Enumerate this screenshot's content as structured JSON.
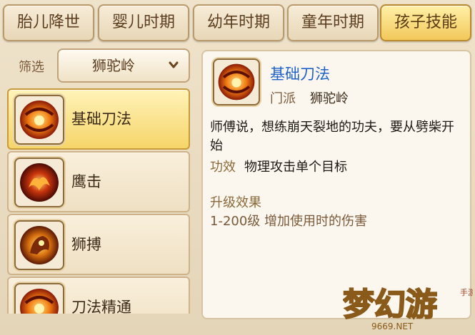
{
  "tabs": [
    {
      "label": "胎儿降世"
    },
    {
      "label": "婴儿时期"
    },
    {
      "label": "幼年时期"
    },
    {
      "label": "童年时期"
    },
    {
      "label": "孩子技能",
      "active": true
    }
  ],
  "filter": {
    "label": "筛选",
    "selected": "狮驼岭"
  },
  "skills": [
    {
      "name": "基础刀法",
      "icon": "fire-claw-skill-icon",
      "selected": true
    },
    {
      "name": "鹰击",
      "icon": "eagle-fire-skill-icon"
    },
    {
      "name": "狮搏",
      "icon": "lion-fire-skill-icon"
    },
    {
      "name": "刀法精通",
      "icon": "fire-claw-skill-icon"
    }
  ],
  "detail": {
    "title": "基础刀法",
    "sect_label": "门派",
    "sect_value": "狮驼岭",
    "description": "师傅说，想练崩天裂地的功夫，要从劈柴开始",
    "effect_label": "功效",
    "effect_value": "物理攻击单个目标",
    "upgrade_label": "升级效果",
    "upgrade_value": "1-200级 增加使用时的伤害"
  },
  "watermark": {
    "logo_text": "梦幻游",
    "side_text": "手游",
    "site_text": "9669.NET"
  },
  "colors": {
    "active_tab": "#f2c85a",
    "title_blue": "#1f62c9",
    "panel_bg": "#fbf7ee"
  }
}
